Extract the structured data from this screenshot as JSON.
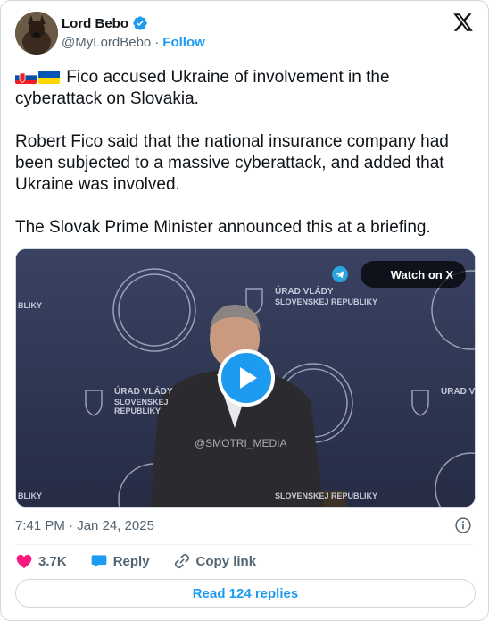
{
  "author": {
    "display_name": "Lord Bebo",
    "handle": "@MyLordBebo",
    "separator": "·",
    "follow_label": "Follow"
  },
  "tweet": {
    "line1": "Fico accused Ukraine of involvement in the cyberattack on Slovakia.",
    "line2": "Robert Fico said that the national insurance company had been subjected to a massive cyberattack, and added that Ukraine was involved.",
    "line3": "The Slovak Prime Minister announced this at a briefing."
  },
  "media": {
    "watch_label": "Watch on X",
    "watermark": "@SMOTRI_MEDIA",
    "backdrop_text_1": "ÚRAD VLÁDY",
    "backdrop_text_2": "SLOVENSKEJ REPUBLIKY",
    "backdrop_text_partial": "BLIKY"
  },
  "meta": {
    "time": "7:41 PM",
    "separator": "·",
    "date": "Jan 24, 2025"
  },
  "actions": {
    "like_count": "3.7K",
    "reply_label": "Reply",
    "copy_label": "Copy link"
  },
  "read_replies_label": "Read 124 replies",
  "colors": {
    "accent": "#1d9bf0",
    "like": "#f91880",
    "muted": "#536471",
    "text": "#0f1419"
  },
  "icons": [
    "verified-badge-icon",
    "x-logo-icon",
    "slovakia-flag-icon",
    "ukraine-flag-icon",
    "telegram-icon",
    "play-icon",
    "info-icon",
    "heart-icon",
    "reply-bubble-icon",
    "link-icon"
  ]
}
